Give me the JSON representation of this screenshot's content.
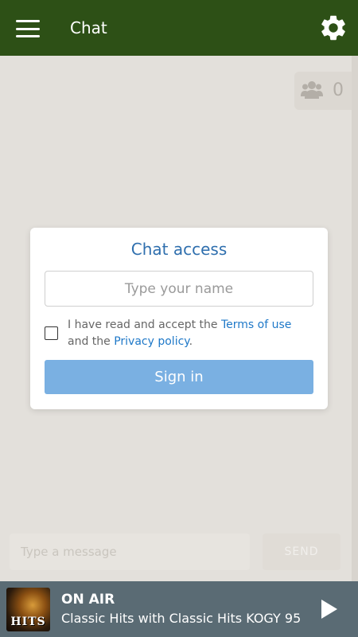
{
  "appbar": {
    "title": "Chat",
    "menu_icon": "hamburger-menu-icon",
    "settings_icon": "gear-icon",
    "color": "#2d5016"
  },
  "users": {
    "icon": "users-group-icon",
    "count": "0"
  },
  "modal": {
    "title": "Chat access",
    "name_placeholder": "Type your name",
    "name_value": "",
    "checkbox_checked": false,
    "terms_prefix": "I have read and accept the ",
    "terms_link": "Terms of use",
    "terms_middle": " and the ",
    "privacy_link": "Privacy policy",
    "terms_suffix": ".",
    "signin_label": "Sign in",
    "accent_color": "#7ab0e2"
  },
  "composer": {
    "message_placeholder": "Type a message",
    "send_label": "SEND"
  },
  "player": {
    "artwork_label": "HITS",
    "status": "ON AIR",
    "now_playing": "Classic Hits with Classic Hits KOGY 95",
    "play_icon": "play-icon"
  }
}
